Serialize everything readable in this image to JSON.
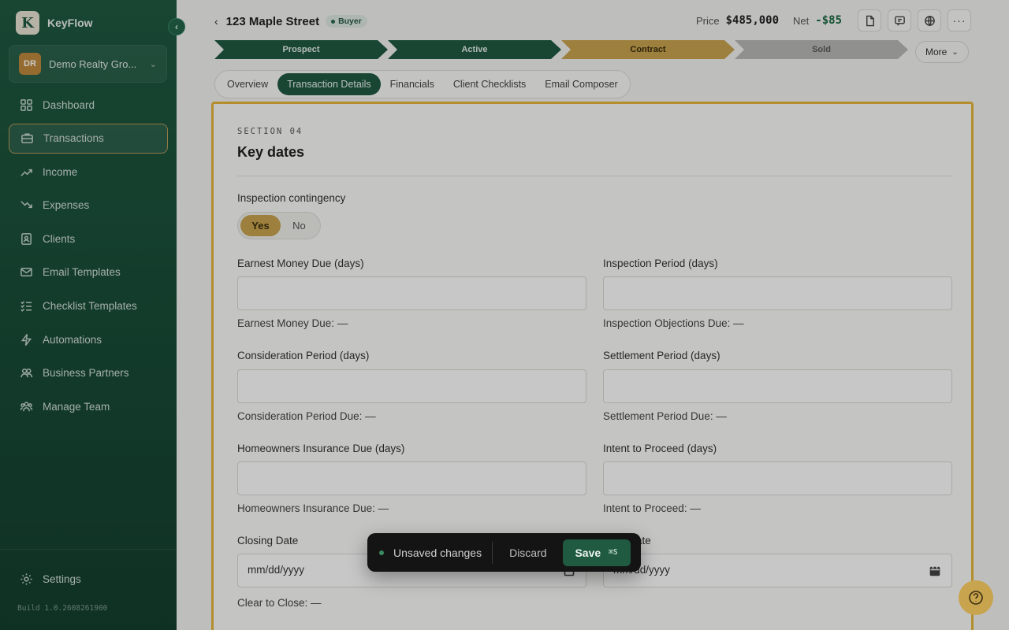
{
  "brand": {
    "name": "KeyFlow",
    "logo_letter": "K"
  },
  "org": {
    "initials": "DR",
    "name": "Demo Realty Gro..."
  },
  "nav": [
    {
      "label": "Dashboard",
      "icon": "dashboard-icon"
    },
    {
      "label": "Transactions",
      "icon": "briefcase-icon",
      "active": true
    },
    {
      "label": "Income",
      "icon": "trend-up-icon"
    },
    {
      "label": "Expenses",
      "icon": "trend-down-icon"
    },
    {
      "label": "Clients",
      "icon": "contacts-icon"
    },
    {
      "label": "Email Templates",
      "icon": "mail-icon"
    },
    {
      "label": "Checklist Templates",
      "icon": "checklist-icon"
    },
    {
      "label": "Automations",
      "icon": "bolt-icon"
    },
    {
      "label": "Business Partners",
      "icon": "partners-icon"
    },
    {
      "label": "Manage Team",
      "icon": "team-icon"
    }
  ],
  "settings_label": "Settings",
  "build": "Build 1.0.2608261900",
  "header": {
    "title": "123 Maple Street",
    "badge": "Buyer",
    "price_label": "Price",
    "price_value": "$485,000",
    "net_label": "Net",
    "net_value": "-$85"
  },
  "pipeline": {
    "stages": [
      {
        "label": "Prospect",
        "state": "done"
      },
      {
        "label": "Active",
        "state": "done"
      },
      {
        "label": "Contract",
        "state": "current"
      },
      {
        "label": "Sold",
        "state": "todo"
      }
    ],
    "more_label": "More"
  },
  "tabs": [
    "Overview",
    "Transaction Details",
    "Financials",
    "Client Checklists",
    "Email Composer"
  ],
  "active_tab": "Transaction Details",
  "section": {
    "label": "SECTION 04",
    "title": "Key dates",
    "contingency_label": "Inspection contingency",
    "toggle_yes": "Yes",
    "toggle_no": "No",
    "fields": {
      "earnest_label": "Earnest Money Due (days)",
      "earnest_note": "Earnest Money Due: —",
      "inspection_label": "Inspection Period (days)",
      "inspection_note": "Inspection Objections Due: —",
      "consideration_label": "Consideration Period (days)",
      "consideration_note": "Consideration Period Due: —",
      "settlement_label": "Settlement Period (days)",
      "settlement_note": "Settlement Period Due: —",
      "insurance_label": "Homeowners Insurance Due (days)",
      "insurance_note": "Homeowners Insurance Due: —",
      "intent_label": "Intent to Proceed (days)",
      "intent_note": "Intent to Proceed: —",
      "closing_label": "Closing Date",
      "closing_value": "mm/dd/yyyy",
      "closing_note": "Clear to Close: —",
      "occupancy_label": "ancy Date",
      "occupancy_value": "mm/dd/yyyy"
    }
  },
  "savebar": {
    "status": "Unsaved changes",
    "discard": "Discard",
    "save": "Save",
    "shortcut": "⌘S"
  }
}
